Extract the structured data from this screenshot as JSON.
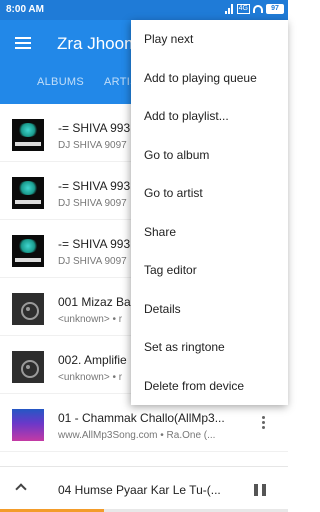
{
  "statusbar": {
    "time": "8:00 AM",
    "battery": "97"
  },
  "toolbar": {
    "title": "Zra Jhoom",
    "tabs": [
      {
        "label": "ALBUMS"
      },
      {
        "label": "ARTIS"
      }
    ]
  },
  "songs": [
    {
      "title": "-= SHIVA 993",
      "subtitle": "DJ SHIVA 9097"
    },
    {
      "title": "-= SHIVA 993",
      "subtitle": "DJ SHIVA 9097"
    },
    {
      "title": "-= SHIVA 993",
      "subtitle": "DJ SHIVA 9097"
    },
    {
      "title": "001 Mizaz Ba",
      "subtitle": "<unknown> • r"
    },
    {
      "title": "002. Amplifie",
      "subtitle": "<unknown> • r"
    },
    {
      "title": "01 - Chammak Challo(AllMp3...",
      "subtitle": "www.AllMp3Song.com • Ra.One (..."
    }
  ],
  "menu": {
    "items": [
      {
        "label": "Play next"
      },
      {
        "label": "Add to playing queue"
      },
      {
        "label": "Add to playlist..."
      },
      {
        "label": "Go to album"
      },
      {
        "label": "Go to artist"
      },
      {
        "label": "Share"
      },
      {
        "label": "Tag editor"
      },
      {
        "label": "Details"
      },
      {
        "label": "Set as ringtone"
      },
      {
        "label": "Delete from device"
      }
    ]
  },
  "miniplayer": {
    "title": "04 Humse Pyaar Kar Le Tu-(...",
    "progress": 0.36
  },
  "icons": {
    "menu": "hamburger-icon",
    "overflow": "more-vert-icon",
    "expand": "chevron-up-icon",
    "pause": "pause-icon"
  },
  "colors": {
    "primary": "#2288e8",
    "statusbar": "#1f7bd7",
    "accent": "#f39c2a"
  }
}
